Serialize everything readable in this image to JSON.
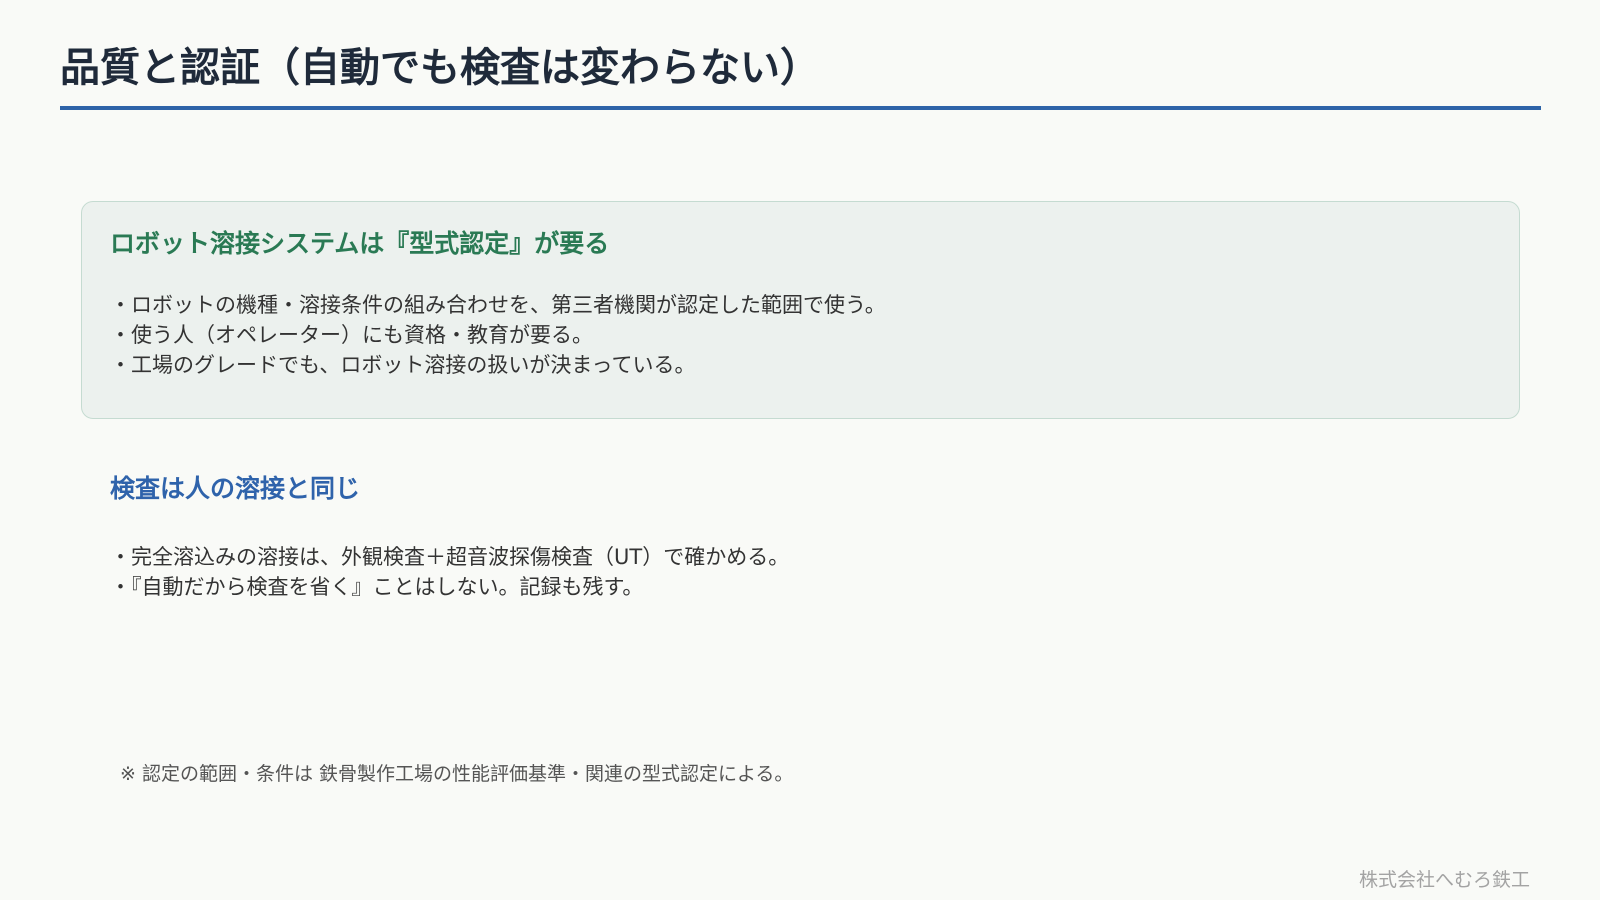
{
  "slide": {
    "title": "品質と認証（自動でも検査は変わらない）",
    "accent_color": "#2e63a8"
  },
  "robot_certification": {
    "heading": "ロボット溶接システムは『型式認定』が要る",
    "heading_color": "#2a7a54",
    "panel_background": "#ecf1ee",
    "bullets": [
      "・ロボットの機種・溶接条件の組み合わせを、第三者機関が認定した範囲で使う。",
      "・使う人（オペレーター）にも資格・教育が要る。",
      "・工場のグレードでも、ロボット溶接の扱いが決まっている。"
    ]
  },
  "inspection": {
    "heading": "検査は人の溶接と同じ",
    "heading_color": "#2f63ab",
    "bullets": [
      "・完全溶込みの溶接は、外観検査＋超音波探傷検査（UT）で確かめる。",
      "・『自動だから検査を省く』ことはしない。記録も残す。"
    ]
  },
  "note": "※ 認定の範囲・条件は 鉄骨製作工場の性能評価基準・関連の型式認定による。",
  "footer": {
    "company": "株式会社へむろ鉄工"
  }
}
